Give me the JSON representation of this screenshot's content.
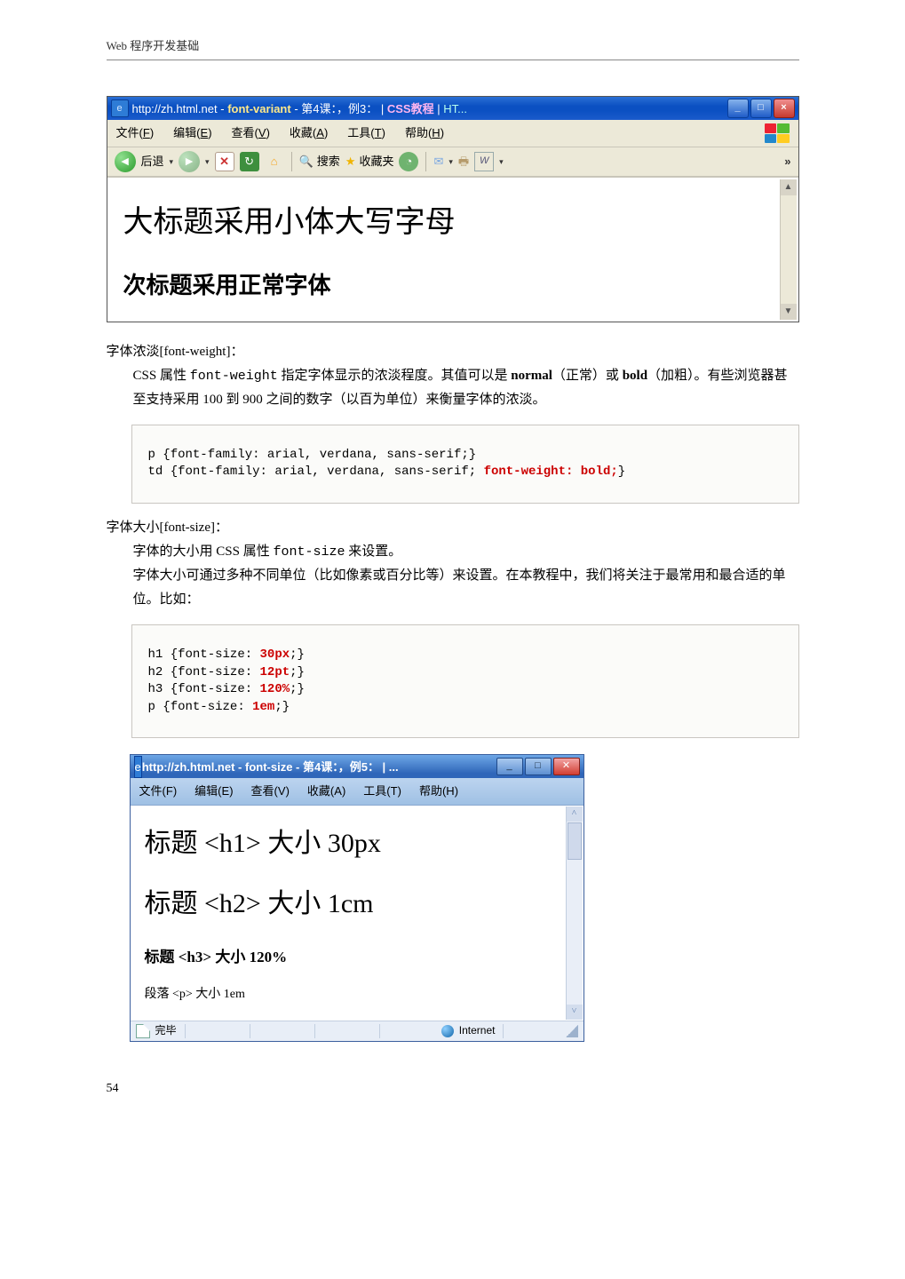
{
  "header": "Web 程序开发基础",
  "page_number": "54",
  "ie1": {
    "title_segments": {
      "a": "http://zh.html.net",
      "b": " - ",
      "c": "font-variant",
      "d": " - ",
      "e": "第4课：，例3：",
      "f": " | ",
      "g": "CSS教程",
      "h": " | ",
      "i": "HT..."
    },
    "menu": {
      "file": "文件",
      "file_k": "F",
      "edit": "编辑",
      "edit_k": "E",
      "view": "查看",
      "view_k": "V",
      "fav": "收藏",
      "fav_k": "A",
      "tool": "工具",
      "tool_k": "T",
      "help": "帮助",
      "help_k": "H"
    },
    "toolbar": {
      "back": "后退",
      "search": "搜索",
      "favorites": "收藏夹"
    },
    "content": {
      "h1": "大标题采用小体大写字母",
      "h2": "次标题采用正常字体"
    }
  },
  "section_weight": {
    "title": "字体浓淡[font-weight]：",
    "para_a": "CSS 属性 ",
    "para_b": "font-weight",
    "para_c": " 指定字体显示的浓淡程度。其值可以是 ",
    "para_d": "normal",
    "para_e": "（正常）或 ",
    "para_f": "bold",
    "para_g": "（加粗）。有些浏览器甚至支持采用 100 到 900 之间的数字（以百为单位）来衡量字体的浓淡。",
    "code_line1_a": "p {font-family: arial, verdana, sans-serif;}",
    "code_line2_a": "td {font-family: arial, verdana, sans-serif; ",
    "code_line2_b": "font-weight: bold;",
    "code_line2_c": "}"
  },
  "section_size": {
    "title": "字体大小[font-size]：",
    "para1_a": "字体的大小用 CSS 属性 ",
    "para1_b": "font-size",
    "para1_c": " 来设置。",
    "para2": "字体大小可通过多种不同单位（比如像素或百分比等）来设置。在本教程中，我们将关注于最常用和最合适的单位。比如：",
    "code_l1_a": "h1 {font-size: ",
    "code_l1_b": "30px",
    "code_l1_c": ";}",
    "code_l2_a": "h2 {font-size: ",
    "code_l2_b": "12pt",
    "code_l2_c": ";}",
    "code_l3_a": "h3 {font-size: ",
    "code_l3_b": "120%",
    "code_l3_c": ";}",
    "code_l4_a": "p {font-size: ",
    "code_l4_b": "1em",
    "code_l4_c": ";}"
  },
  "ie2": {
    "title": "http://zh.html.net - font-size - 第4课：，例5：   | ...",
    "menu": {
      "file": "文件",
      "file_k": "F",
      "edit": "编辑",
      "edit_k": "E",
      "view": "查看",
      "view_k": "V",
      "fav": "收藏",
      "fav_k": "A",
      "tool": "工具",
      "tool_k": "T",
      "help": "帮助",
      "help_k": "H"
    },
    "content": {
      "l1": "标题 <h1> 大小 30px",
      "l2": "标题 <h2> 大小 1cm",
      "l3": "标题 <h3> 大小 120%",
      "l4": "段落 <p> 大小 1em"
    },
    "status": {
      "done": "完毕",
      "zone": "Internet"
    }
  }
}
